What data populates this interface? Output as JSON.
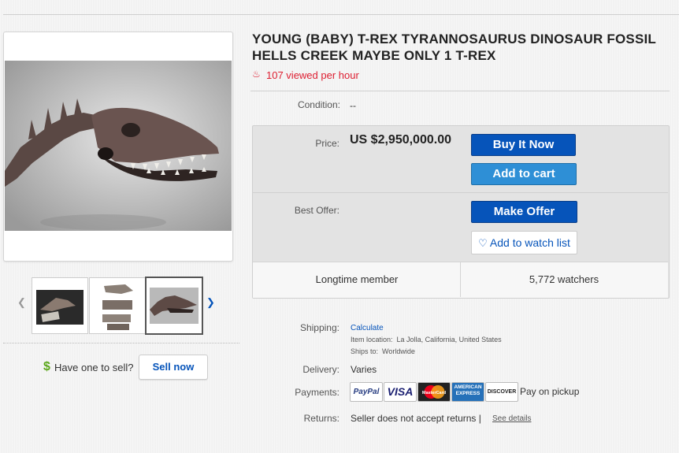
{
  "title": "YOUNG (BABY) T-REX TYRANNOSAURUS DINOSAUR FOSSIL HELLS CREEK MAYBE ONLY 1 T-REX",
  "views": "107 viewed per hour",
  "condition": {
    "label": "Condition:",
    "value": "--"
  },
  "price": {
    "label": "Price:",
    "value": "US $2,950,000.00"
  },
  "buttons": {
    "buy_now": "Buy It Now",
    "add_to_cart": "Add to cart",
    "make_offer": "Make Offer",
    "watch_list": "Add to watch list"
  },
  "best_offer_label": "Best Offer:",
  "seller_info": {
    "member": "Longtime member",
    "watchers": "5,772 watchers"
  },
  "shipping": {
    "label": "Shipping:",
    "calculate": "Calculate",
    "location_label": "Item location:",
    "location": "La Jolla, California, United States",
    "ships_label": "Ships to:",
    "ships_to": "Worldwide"
  },
  "delivery": {
    "label": "Delivery:",
    "value": "Varies"
  },
  "payments": {
    "label": "Payments:",
    "methods": [
      "PayPal",
      "VISA",
      "MasterCard",
      "AMERICAN EXPRESS",
      "DISCOVER"
    ],
    "extra": "Pay on pickup"
  },
  "returns": {
    "label": "Returns:",
    "value": "Seller does not accept returns |",
    "link": "See details"
  },
  "sell": {
    "text": "Have one to sell?",
    "button": "Sell now"
  },
  "colors": {
    "accent": "#0654ba",
    "views_red": "#dd1e31",
    "cart_blue": "#2e8fd6",
    "sell_green": "#5ba71b"
  },
  "icons": {
    "views": "fire-icon",
    "watch": "heart-icon",
    "prev": "chevron-left-icon",
    "next": "chevron-right-icon",
    "sell": "dollar-icon"
  }
}
